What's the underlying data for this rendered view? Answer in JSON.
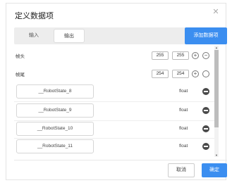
{
  "dialog": {
    "title": "定义数据项",
    "close_icon": "close-icon"
  },
  "tabs": [
    {
      "label": "输入",
      "active": false
    },
    {
      "label": "输出",
      "active": true
    }
  ],
  "add_button_label": "添加数据项",
  "header_row": {
    "label": "帧头",
    "value1": "255",
    "value2": "255",
    "add_icon": "plus-circle-icon",
    "remove_icon": "minus-circle-icon"
  },
  "footer_row": {
    "label": "帧尾",
    "value1": "254",
    "value2": "254",
    "add_icon": "plus-circle-icon",
    "remove_icon": "circle-icon"
  },
  "items": [
    {
      "name": "__RobotState_8",
      "type": "float"
    },
    {
      "name": "__RobotState_9",
      "type": "float"
    },
    {
      "name": "__RobotState_10",
      "type": "float"
    },
    {
      "name": "__RobotState_11",
      "type": "float"
    }
  ],
  "buttons": {
    "cancel": "取消",
    "ok": "确定"
  },
  "colors": {
    "accent": "#3b8ef0",
    "remove_icon": "#4a4a4a"
  }
}
